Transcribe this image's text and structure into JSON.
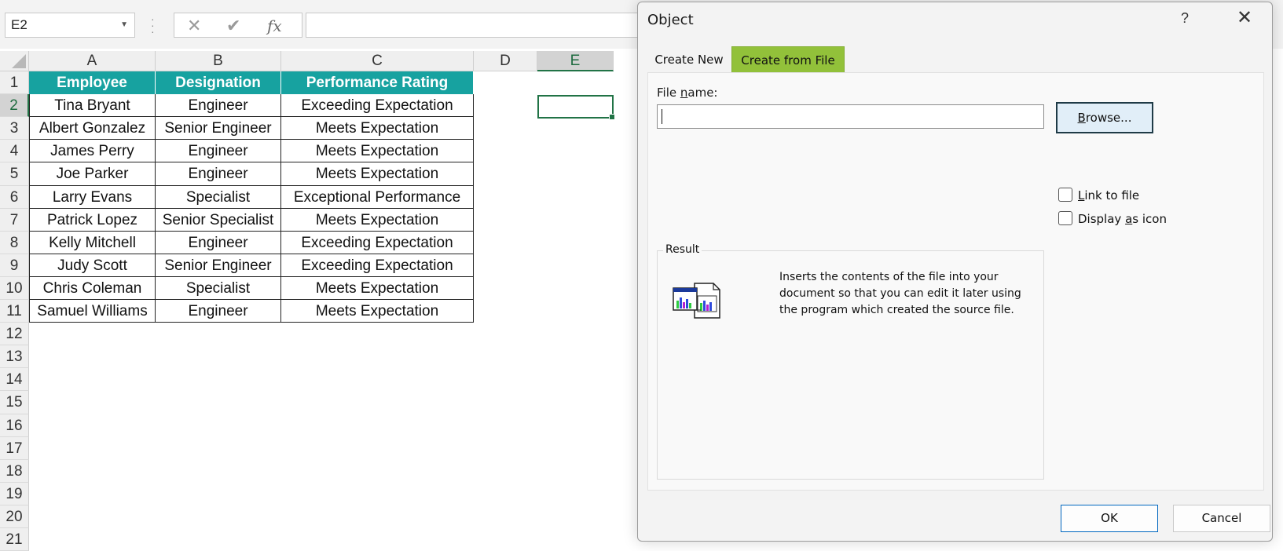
{
  "formula_bar": {
    "name_box": "E2",
    "cancel_glyph": "✕",
    "enter_glyph": "✔",
    "fx_glyph": "fx",
    "formula_value": ""
  },
  "sheet": {
    "columns": [
      "A",
      "B",
      "C",
      "D",
      "E"
    ],
    "selected_column": "E",
    "selected_row": 2,
    "rows": [
      "1",
      "2",
      "3",
      "4",
      "5",
      "6",
      "7",
      "8",
      "9",
      "10",
      "11",
      "12",
      "13",
      "14",
      "15",
      "16",
      "17",
      "18",
      "19",
      "20",
      "21"
    ],
    "table": {
      "headers": [
        "Employee",
        "Designation",
        "Performance Rating"
      ],
      "data": [
        [
          "Tina Bryant",
          "Engineer",
          "Exceeding Expectation"
        ],
        [
          "Albert Gonzalez",
          "Senior Engineer",
          "Meets Expectation"
        ],
        [
          "James Perry",
          "Engineer",
          "Meets Expectation"
        ],
        [
          "Joe Parker",
          "Engineer",
          "Meets Expectation"
        ],
        [
          "Larry Evans",
          "Specialist",
          "Exceptional Performance"
        ],
        [
          "Patrick Lopez",
          "Senior Specialist",
          "Meets Expectation"
        ],
        [
          "Kelly Mitchell",
          "Engineer",
          "Exceeding Expectation"
        ],
        [
          "Judy Scott",
          "Senior Engineer",
          "Exceeding Expectation"
        ],
        [
          "Chris Coleman",
          "Specialist",
          "Meets Expectation"
        ],
        [
          "Samuel Williams",
          "Engineer",
          "Meets Expectation"
        ]
      ],
      "header_color": "#17a2a0"
    }
  },
  "dialog": {
    "title": "Object",
    "help_glyph": "?",
    "close_glyph": "✕",
    "tabs": [
      {
        "label": "Create New",
        "active": false
      },
      {
        "label": "Create from File",
        "active": true
      }
    ],
    "active_tab_color": "#92c13a",
    "file_name_label_pre": "File ",
    "file_name_label_ul": "n",
    "file_name_label_post": "ame:",
    "file_name_value": "",
    "browse_ul": "B",
    "browse_rest": "rowse...",
    "link_ul": "L",
    "link_rest": "ink to file",
    "link_checked": false,
    "icon_pre": "Display ",
    "icon_ul": "a",
    "icon_post": "s icon",
    "icon_checked": false,
    "result_label": "Result",
    "result_text": "Inserts the contents of the file into your document so that you can edit it later using the program which created the source file.",
    "result_icon": "embedded-object-icon",
    "ok_label": "OK",
    "cancel_label": "Cancel"
  }
}
